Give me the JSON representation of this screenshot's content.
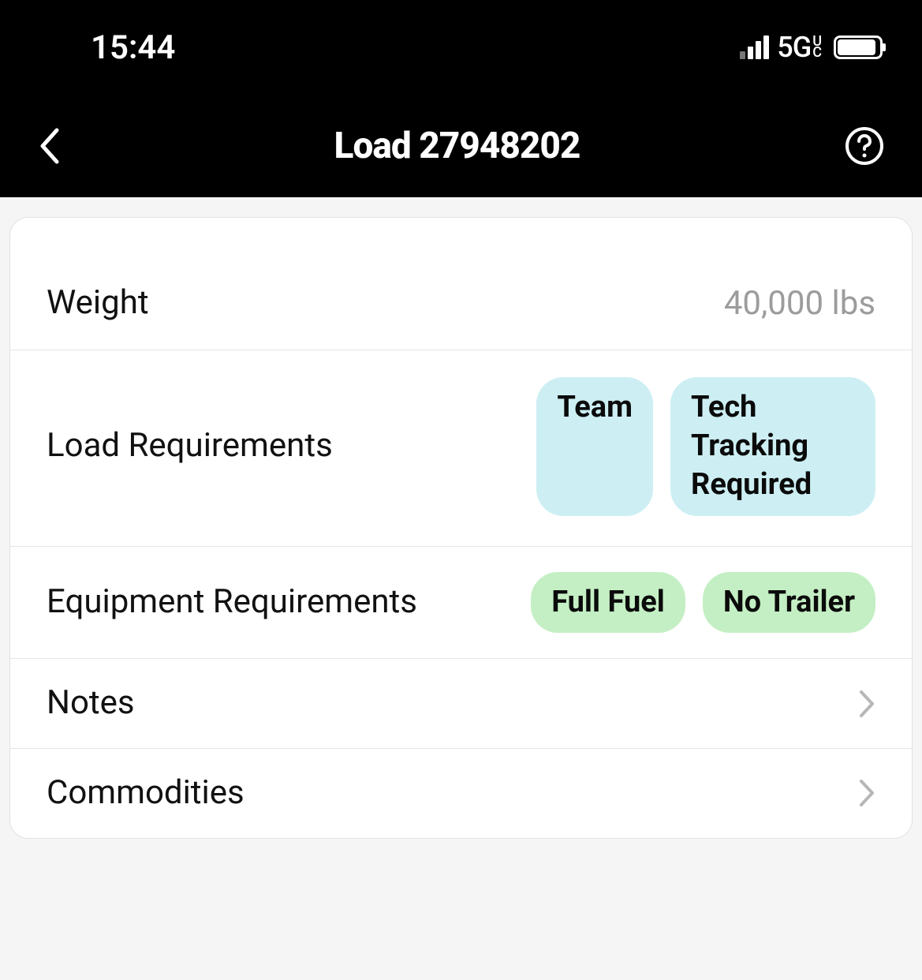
{
  "status": {
    "time": "15:44",
    "network": "5G",
    "network_sub_top": "U",
    "network_sub_bottom": "C"
  },
  "nav": {
    "title": "Load 27948202"
  },
  "details": {
    "weight_label": "Weight",
    "weight_value": "40,000 lbs",
    "load_req_label": "Load Requirements",
    "load_req_tags": [
      "Team",
      "Tech Tracking Required"
    ],
    "equip_req_label": "Equipment Requirements",
    "equip_req_tags": [
      "Full Fuel",
      "No Trailer"
    ],
    "notes_label": "Notes",
    "commodities_label": "Commodities"
  }
}
